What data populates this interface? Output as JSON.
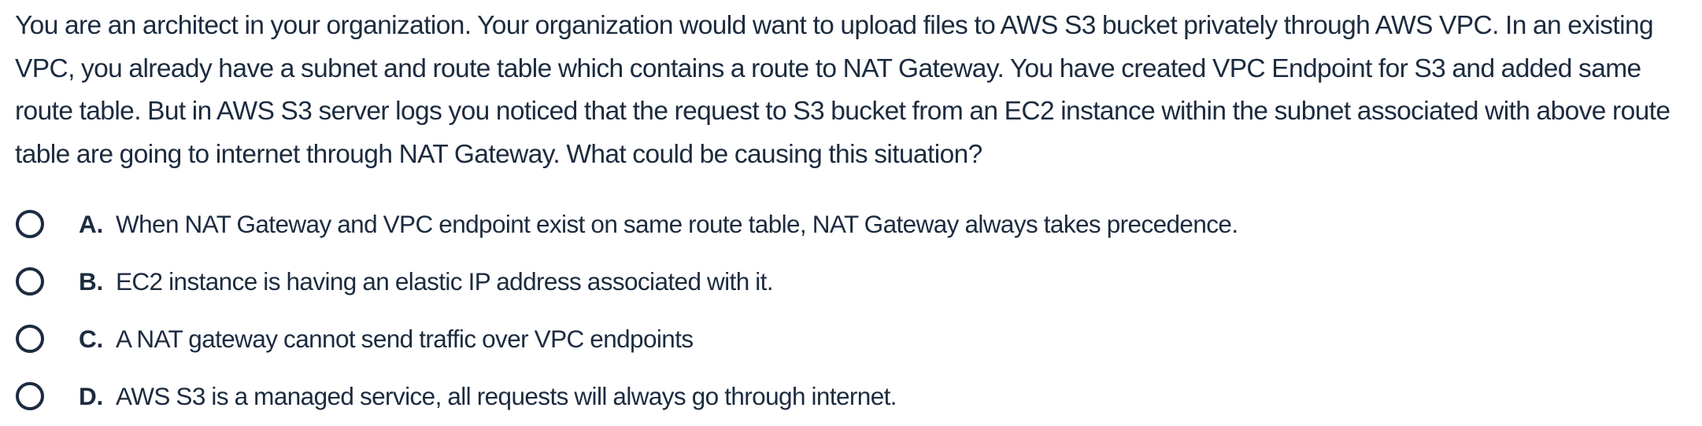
{
  "question": {
    "text": "You are an architect in your organization. Your organization would want to upload files to AWS S3 bucket privately through AWS VPC. In an existing VPC, you already have a subnet and route table which contains a route to NAT Gateway. You have created VPC Endpoint for S3 and added same route table. But in AWS S3 server logs you noticed that the request to S3 bucket from an EC2 instance within the subnet associated with above route table are going to internet through NAT Gateway. What could be causing this situation?"
  },
  "options": [
    {
      "letter": "A.",
      "text": "When NAT Gateway and VPC endpoint exist on same route table, NAT Gateway always takes precedence.",
      "selected": false
    },
    {
      "letter": "B.",
      "text": "EC2 instance is having an elastic IP address associated with it.",
      "selected": false
    },
    {
      "letter": "C.",
      "text": "A NAT gateway cannot send traffic over VPC endpoints",
      "selected": false
    },
    {
      "letter": "D.",
      "text": "AWS S3 is a managed service, all requests will always go through internet.",
      "selected": false
    }
  ],
  "colors": {
    "text": "#1c2b3f",
    "background": "#ffffff"
  }
}
